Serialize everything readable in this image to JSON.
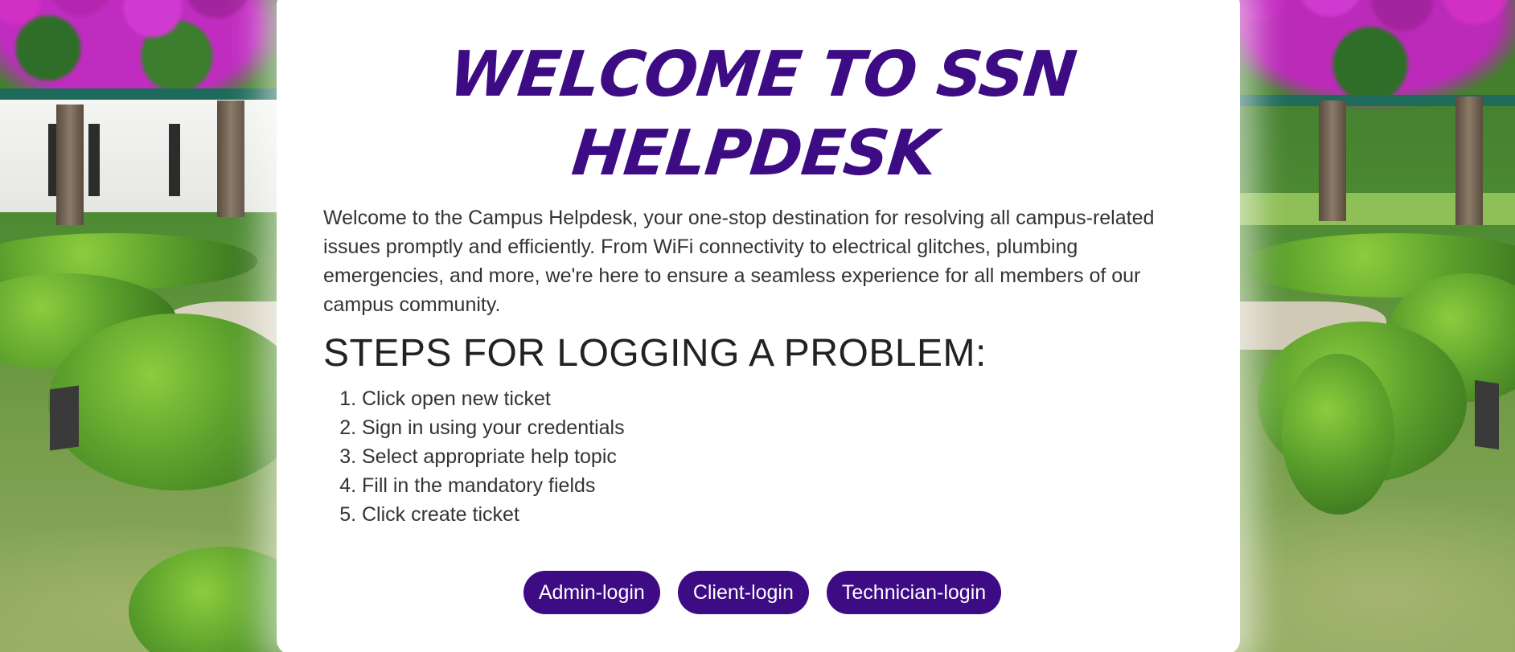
{
  "page": {
    "title": "WELCOME TO SSN HELPDESK",
    "accent_color": "#3d0b84",
    "background": "garden-photo"
  },
  "intro": {
    "text": "Welcome to the Campus Helpdesk, your one-stop destination for resolving all campus-related issues promptly and efficiently. From WiFi connectivity to electrical glitches, plumbing emergencies, and more, we're here to ensure a seamless experience for all members of our campus community."
  },
  "steps": {
    "heading": "STEPS FOR LOGGING A PROBLEM:",
    "items": [
      "Click open new ticket",
      "Sign in using your credentials",
      "Select appropriate help topic",
      "Fill in the mandatory fields",
      "Click create ticket"
    ]
  },
  "buttons": {
    "admin": "Admin-login",
    "client": "Client-login",
    "technician": "Technician-login"
  }
}
